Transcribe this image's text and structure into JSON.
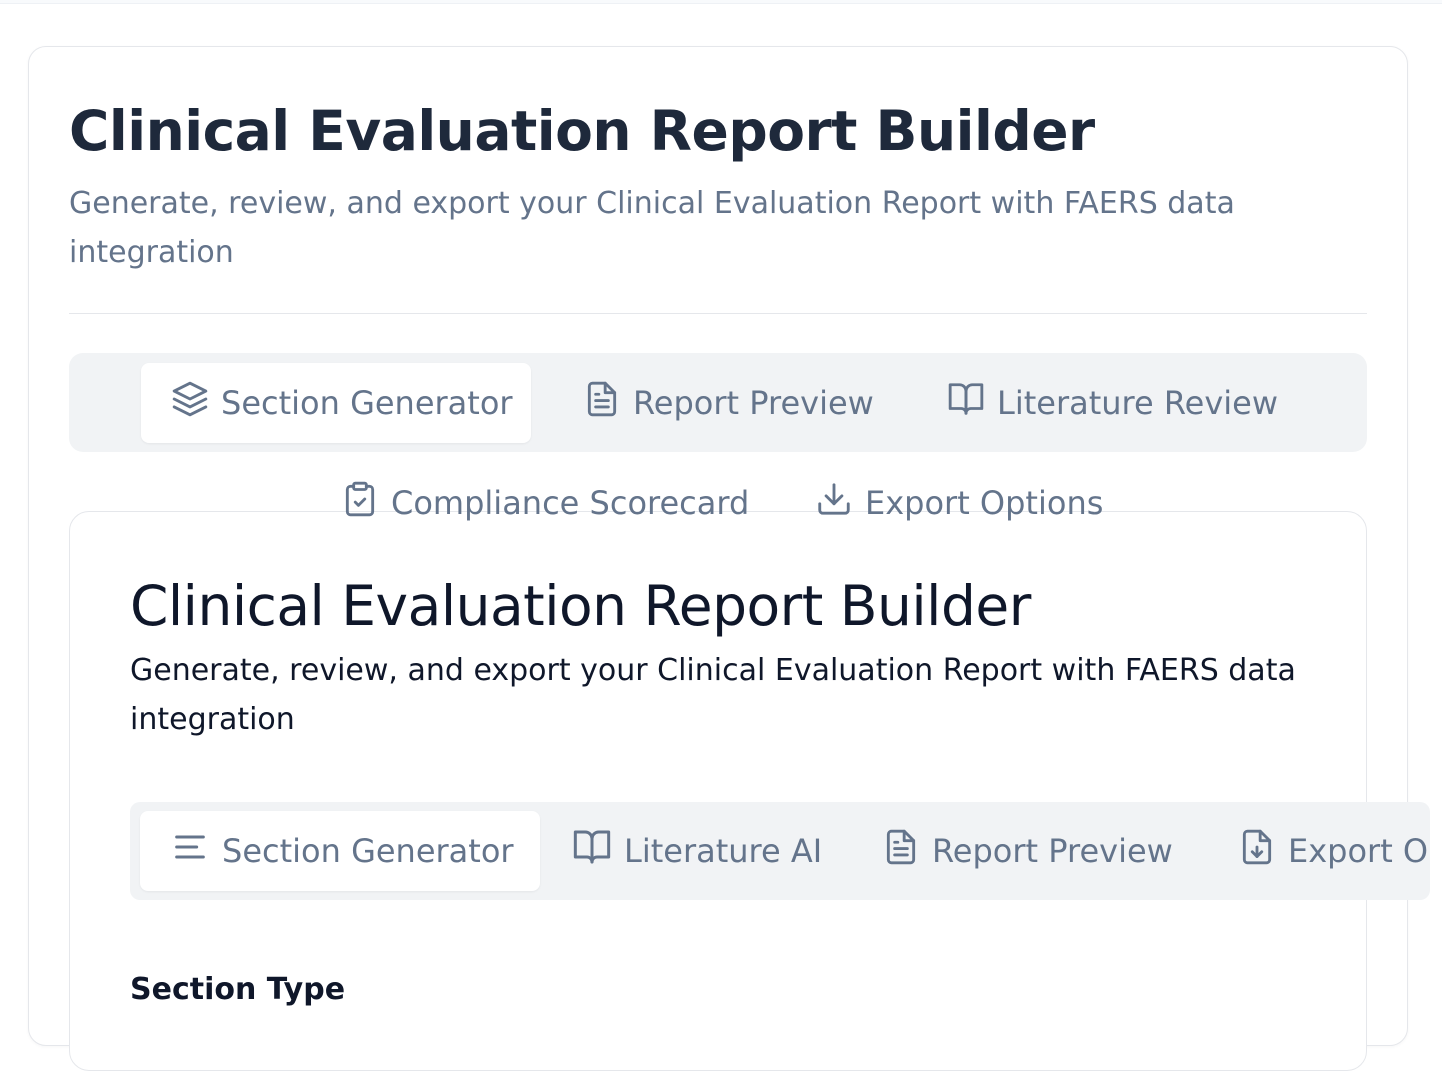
{
  "header": {
    "title": "Clinical Evaluation Report Builder",
    "subtitle": "Generate, review, and export your Clinical Evaluation Report with FAERS data integration"
  },
  "main_tabs": [
    {
      "label": "Section Generator",
      "icon": "layers-icon",
      "active": true
    },
    {
      "label": "Report Preview",
      "icon": "file-text-icon",
      "active": false
    },
    {
      "label": "Literature Review",
      "icon": "book-open-icon",
      "active": false
    },
    {
      "label": "Compliance Scorecard",
      "icon": "clipboard-check-icon",
      "active": false
    },
    {
      "label": "Export Options",
      "icon": "download-icon",
      "active": false
    }
  ],
  "panel": {
    "title": "Clinical Evaluation Report Builder",
    "subtitle": "Generate, review, and export your Clinical Evaluation Report with FAERS data integration",
    "tabs": [
      {
        "label": "Section Generator",
        "icon": "align-left-icon",
        "active": true
      },
      {
        "label": "Literature AI",
        "icon": "book-open-icon",
        "active": false
      },
      {
        "label": "Report Preview",
        "icon": "file-text-icon",
        "active": false
      },
      {
        "label": "Export Options",
        "icon": "file-download-icon",
        "active": false
      }
    ],
    "section_type_label": "Section Type"
  },
  "colors": {
    "title": "#1e293b",
    "muted": "#64748b",
    "tabbar_bg": "#f1f3f5",
    "border": "#e5e7eb"
  }
}
